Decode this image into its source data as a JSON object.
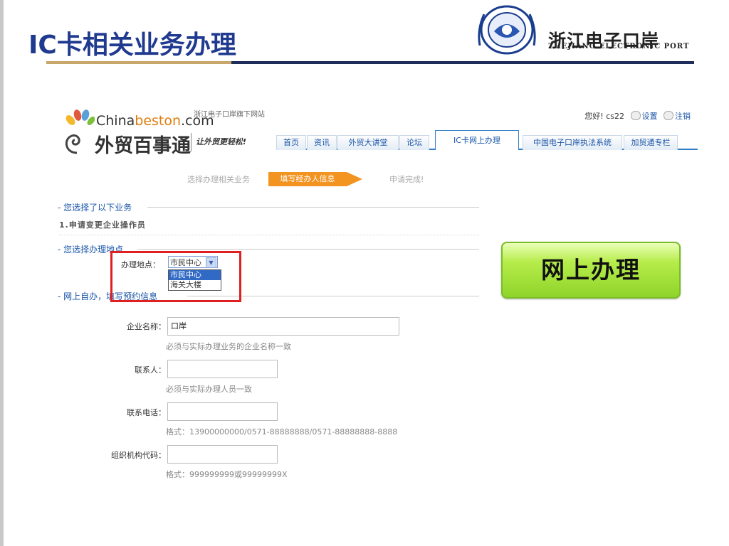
{
  "slide": {
    "title": "IC卡相关业务办理",
    "brand_cn": "浙江电子口岸",
    "brand_en": "ZHEJIANG ELECTRONIC PORT"
  },
  "site": {
    "brand_en_a": "China",
    "brand_en_b": "beston",
    "brand_en_c": ".com",
    "brand_sub": "浙江电子口岸旗下网站",
    "brand_cn": "外贸百事通",
    "slogan": "让外贸更轻松!",
    "greeting": {
      "hello": "您好!",
      "user": "cs22",
      "settings": "设置",
      "logout": "注销"
    },
    "nav": [
      {
        "label": "首页"
      },
      {
        "label": "资讯"
      },
      {
        "label": "外贸大讲堂"
      },
      {
        "label": "论坛"
      },
      {
        "label": "IC卡网上办理",
        "active": true
      },
      {
        "label": "中国电子口岸执法系统"
      },
      {
        "label": "加贸通专栏"
      }
    ],
    "steps": [
      "选择办理相关业务",
      "填写经办人信息",
      "申请完成!"
    ],
    "sections": {
      "business": "- 您选择了以下业务",
      "business_item": "1.申请变更企业操作员",
      "location": "- 您选择办理地点",
      "form": "- 网上自办，填写预约信息"
    },
    "location": {
      "label": "办理地点：",
      "selected": "市民中心",
      "options": [
        "市民中心",
        "海关大楼"
      ]
    },
    "form": {
      "company_label": "企业名称：",
      "company_value": "口岸",
      "company_hint": "必须与实际办理业务的企业名称一致",
      "contact_label": "联系人：",
      "contact_value": "",
      "contact_hint": "必须与实际办理人员一致",
      "phone_label": "联系电话：",
      "phone_value": "",
      "phone_hint": "格式：13900000000/0571-88888888/0571-88888888-8888",
      "org_label": "组织机构代码：",
      "org_value": "",
      "org_hint": "格式：999999999或99999999X"
    }
  },
  "callout": {
    "label": "网上办理",
    "color": "#8fd42a"
  },
  "highlight_color": "#e02020"
}
